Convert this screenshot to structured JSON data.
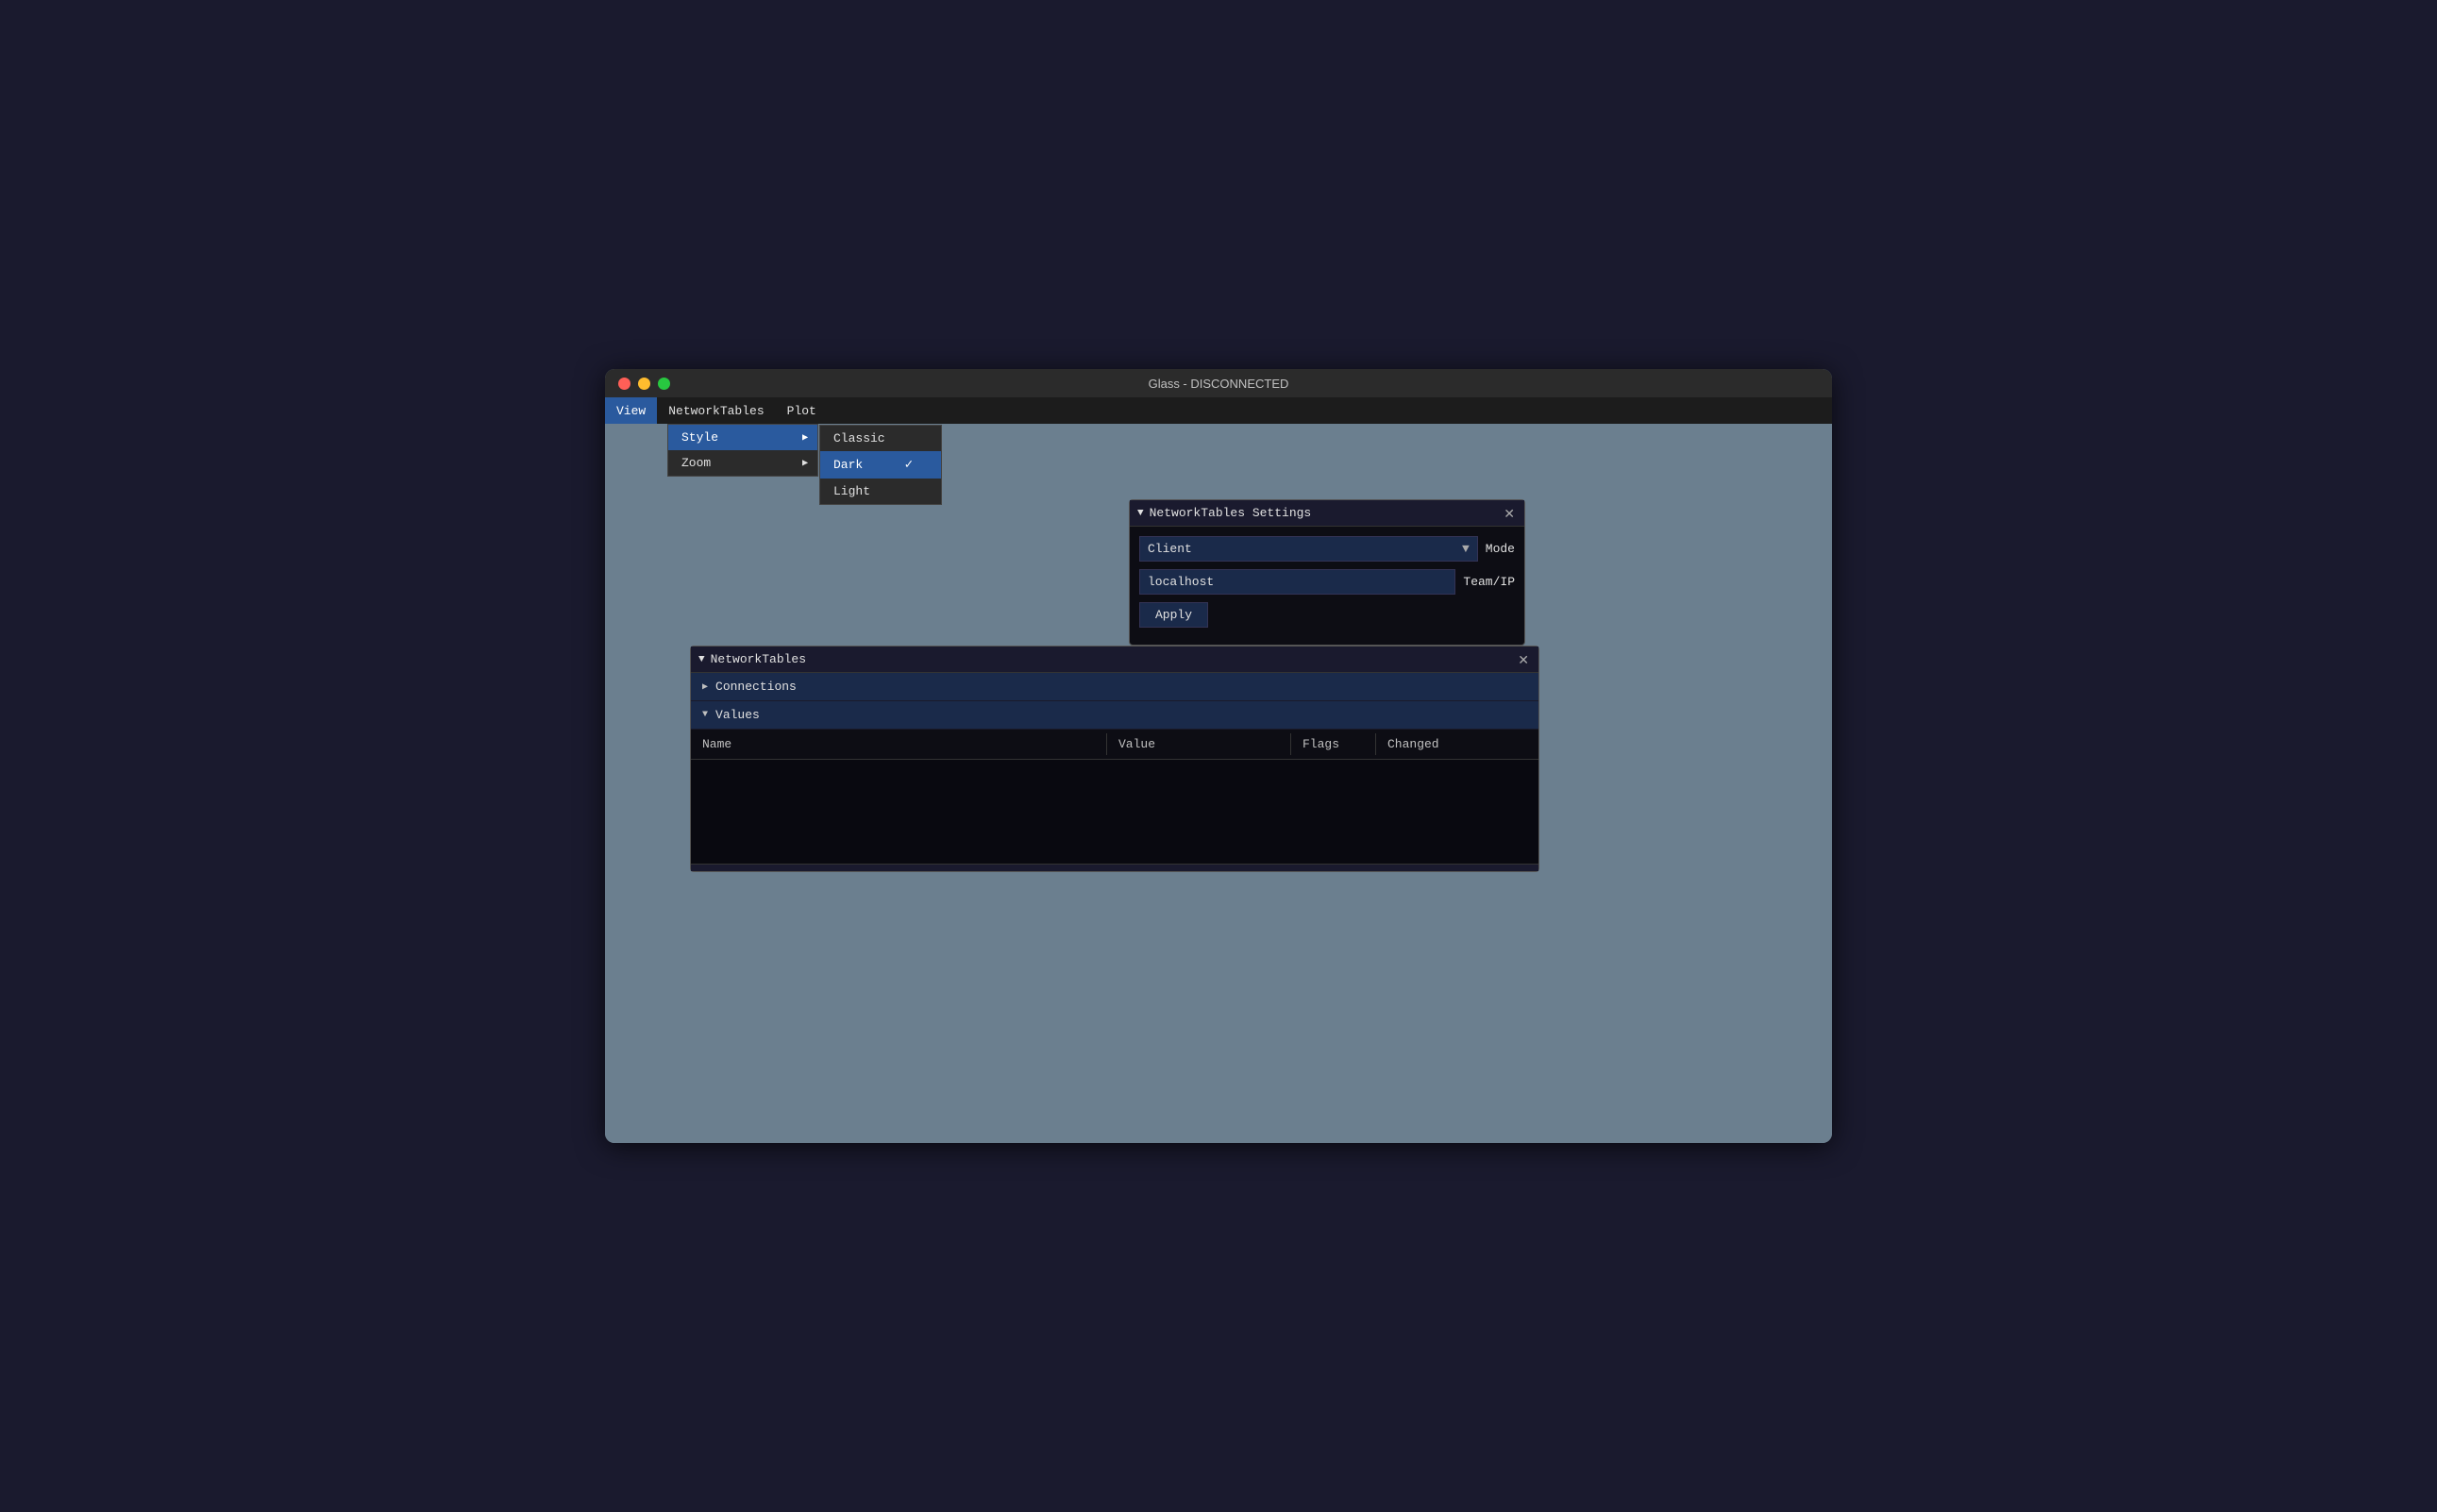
{
  "window": {
    "title": "Glass - DISCONNECTED",
    "controls": {
      "close": "close",
      "minimize": "minimize",
      "maximize": "maximize"
    }
  },
  "menubar": {
    "items": [
      {
        "id": "view",
        "label": "View",
        "active": true
      },
      {
        "id": "networktables",
        "label": "NetworkTables",
        "active": false
      },
      {
        "id": "plot",
        "label": "Plot",
        "active": false
      }
    ]
  },
  "view_menu": {
    "items": [
      {
        "id": "style",
        "label": "Style",
        "has_submenu": true
      },
      {
        "id": "zoom",
        "label": "Zoom",
        "has_submenu": true
      }
    ]
  },
  "style_submenu": {
    "items": [
      {
        "id": "classic",
        "label": "Classic",
        "selected": false
      },
      {
        "id": "dark",
        "label": "Dark",
        "selected": true
      },
      {
        "id": "light",
        "label": "Light",
        "selected": false
      }
    ]
  },
  "nt_settings": {
    "title": "NetworkTables Settings",
    "mode_label": "Mode",
    "client_label": "Client",
    "team_ip_label": "Team/IP",
    "server_value": "localhost",
    "apply_label": "Apply"
  },
  "nt_panel": {
    "title": "NetworkTables",
    "connections_label": "Connections",
    "values_label": "Values",
    "table_headers": {
      "name": "Name",
      "value": "Value",
      "flags": "Flags",
      "changed": "Changed"
    }
  },
  "colors": {
    "accent_blue": "#2a5a9e",
    "bg_dark": "#0d0d14",
    "bg_medium": "#1a1a2e",
    "row_blue": "#1a2a4a",
    "text_light": "#e0e0e0",
    "border": "#333333"
  }
}
